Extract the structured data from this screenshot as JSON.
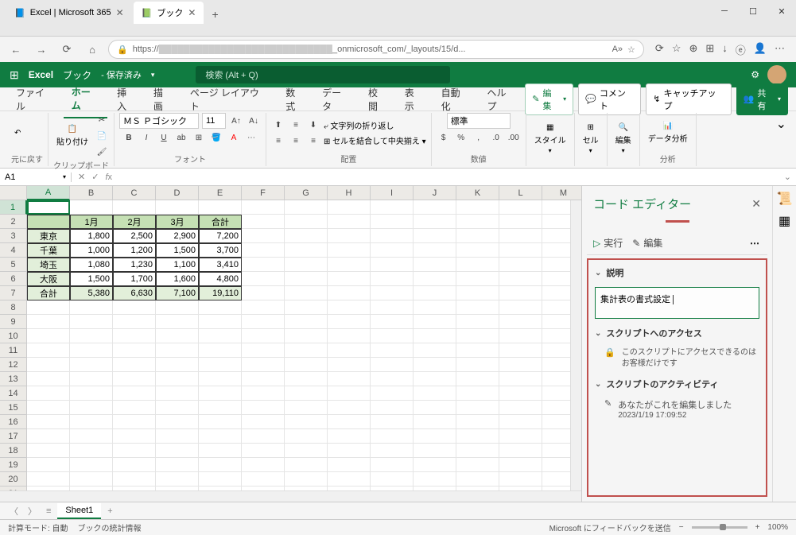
{
  "browser": {
    "tabs": [
      {
        "icon": "📘",
        "title": "Excel | Microsoft 365"
      },
      {
        "icon": "📗",
        "title": "ブック"
      }
    ],
    "url_prefix": "https://",
    "url_suffix": "_onmicrosoft_com/_layouts/15/d...",
    "url_reader": "A»"
  },
  "excel_header": {
    "app_name": "Excel",
    "doc_name": "ブック",
    "doc_status": "- 保存済み",
    "search_placeholder": "検索 (Alt + Q)"
  },
  "ribbon_tabs": [
    "ファイル",
    "ホーム",
    "挿入",
    "描画",
    "ページ レイアウト",
    "数式",
    "データ",
    "校閲",
    "表示",
    "自動化",
    "ヘルプ"
  ],
  "ribbon_actions": {
    "edit": "編集",
    "comments": "コメント",
    "catchup": "キャッチアップ",
    "share": "共有"
  },
  "ribbon_groups": {
    "undo": "元に戻す",
    "clipboard": "クリップボード",
    "clipboard_paste": "貼り付け",
    "font": "フォント",
    "font_name": "ＭＳ Ｐゴシック",
    "font_size": "11",
    "alignment": "配置",
    "wrap_text": "文字列の折り返し",
    "merge_center": "セルを結合して中央揃え",
    "number": "数値",
    "number_format": "標準",
    "styles": "スタイル",
    "cells": "セル",
    "editing": "編集",
    "analysis": "分析",
    "data_analysis": "データ分析"
  },
  "name_box": "A1",
  "chart_data": {
    "type": "table",
    "columns": [
      "",
      "1月",
      "2月",
      "3月",
      "合計"
    ],
    "rows": [
      [
        "東京",
        "1,800",
        "2,500",
        "2,900",
        "7,200"
      ],
      [
        "千葉",
        "1,000",
        "1,200",
        "1,500",
        "3,700"
      ],
      [
        "埼玉",
        "1,080",
        "1,230",
        "1,100",
        "3,410"
      ],
      [
        "大阪",
        "1,500",
        "1,700",
        "1,600",
        "4,800"
      ],
      [
        "合計",
        "5,380",
        "6,630",
        "7,100",
        "19,110"
      ]
    ]
  },
  "code_editor": {
    "title": "コード エディター",
    "run": "実行",
    "edit": "編集",
    "section_description": "説明",
    "description_text": "集計表の書式設定",
    "section_access": "スクリプトへのアクセス",
    "access_text": "このスクリプトにアクセスできるのはお客様だけです",
    "section_activity": "スクリプトのアクティビティ",
    "activity_text": "あなたがこれを編集しました",
    "activity_time": "2023/1/19 17:09:52"
  },
  "sheet_tabs": {
    "sheet1": "Sheet1"
  },
  "status_bar": {
    "calc_mode": "計算モード: 自動",
    "book_stats": "ブックの統計情報",
    "feedback": "Microsoft にフィードバックを送信",
    "zoom": "100%"
  }
}
